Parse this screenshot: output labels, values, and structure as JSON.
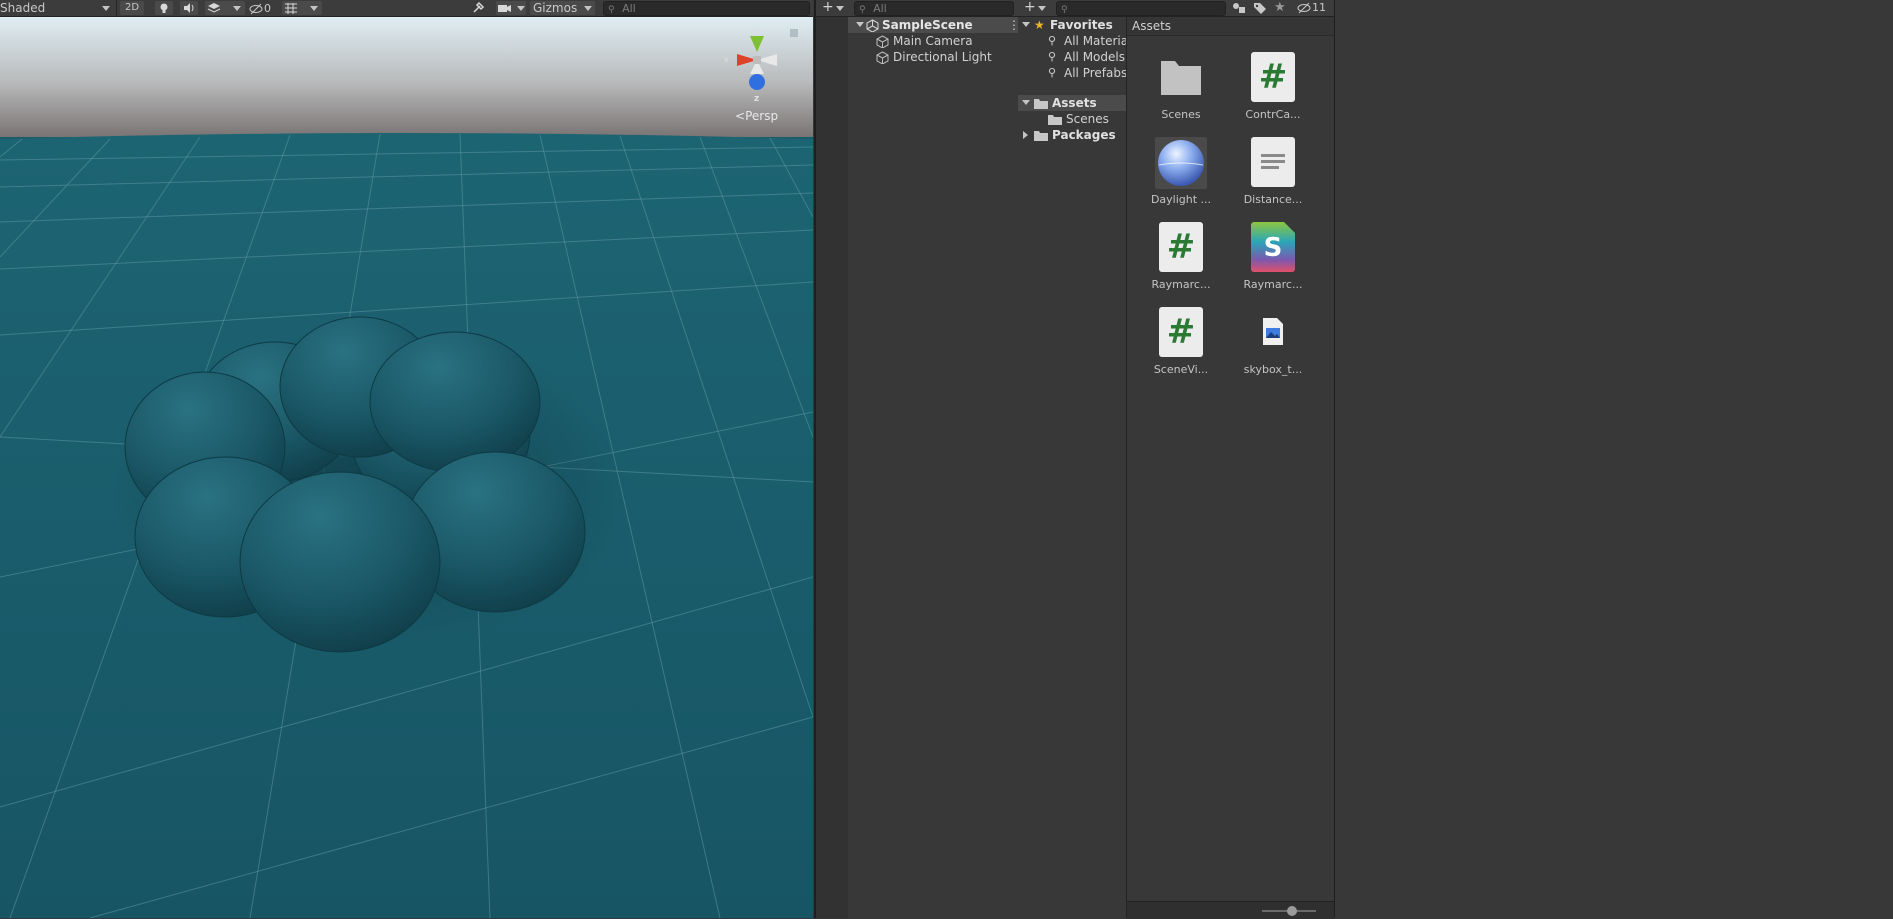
{
  "scene": {
    "shading_mode": "Shaded",
    "mode_2d": "2D",
    "hidden_count": "0",
    "gizmos_label": "Gizmos",
    "search_placeholder": "All",
    "projection_label": "Persp",
    "axis_y": "y",
    "axis_z": "z",
    "axis_x": "x"
  },
  "hierarchy": {
    "search_placeholder": "All",
    "scene_name": "SampleScene",
    "objects": [
      "Main Camera",
      "Directional Light"
    ]
  },
  "project": {
    "hidden_count": "11",
    "favorites": {
      "label": "Favorites",
      "items": [
        "All Materia",
        "All Models",
        "All Prefabs"
      ]
    },
    "assets_folder": "Assets",
    "scenes_folder": "Scenes",
    "packages_folder": "Packages",
    "breadcrumb": "Assets",
    "assets": [
      {
        "label": "Scenes",
        "icon": "folder-icon"
      },
      {
        "label": "ContrCa...",
        "icon": "csharp-script-icon"
      },
      {
        "label": "Daylight ...",
        "icon": "skybox-material-icon"
      },
      {
        "label": "Distance...",
        "icon": "text-file-icon"
      },
      {
        "label": "Raymarc...",
        "icon": "csharp-script-icon"
      },
      {
        "label": "Raymarc...",
        "icon": "shader-icon"
      },
      {
        "label": "SceneVi...",
        "icon": "csharp-script-icon"
      },
      {
        "label": "skybox_t...",
        "icon": "image-icon"
      }
    ],
    "zoom_level": 0.55
  },
  "colors": {
    "ground": "#1a5a69",
    "sky_top": "#dfeef3",
    "horizon": "#7a7474",
    "panel": "#383838",
    "script_green": "#2a7a34",
    "favorite_star": "#e8b42b"
  }
}
